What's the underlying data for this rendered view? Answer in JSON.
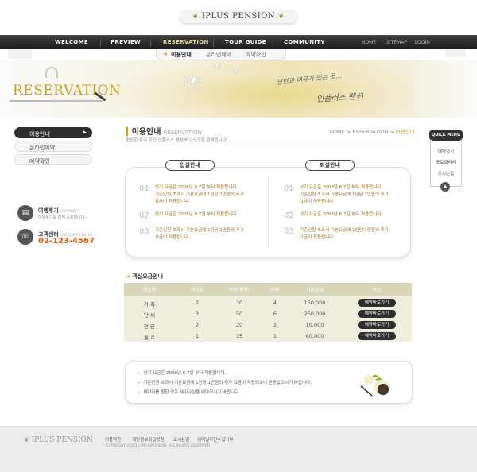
{
  "brand": {
    "logo": "IPLUS PENSION"
  },
  "nav": {
    "items": [
      "WELCOME",
      "PREVIEW",
      "RESERVATION",
      "TOUR GUIDE",
      "COMMUNITY"
    ],
    "active": "RESERVATION",
    "utility": [
      "HOME",
      "SITEMAP",
      "LOGIN"
    ],
    "sub": [
      "이용안내",
      "온라인예약",
      "예약확인"
    ]
  },
  "banner": {
    "title": "RESERVATION",
    "script1": "낭만과 여유가 있는 곳...",
    "script2": "인플러스 펜션"
  },
  "sidebar": {
    "items": [
      "이용안내",
      "온라인예약",
      "예약확인"
    ],
    "review": {
      "title": "여행후기",
      "en": "COMMUNITY",
      "text": "여행후기를 함께 공유합니다."
    },
    "center": {
      "title": "고객센터",
      "en": "CUSTOMER CENTER",
      "phone": "02-123-4567"
    }
  },
  "page": {
    "title": "이용안내",
    "title_en": "RESERVATION",
    "breadcrumb": {
      "home": "HOME",
      "sep": " > ",
      "section": "RESERVATION",
      "current": "이용안내"
    },
    "desc": "편안한 휴식 공간 인플러스 펜션에 오신것을 환영합니다."
  },
  "checkin": {
    "title": "입실안내",
    "items": [
      {
        "num": "01",
        "lines": [
          "성기 요금은 2008년 6.7일 부터 적용합니다",
          "기준인원 초과시 기본요금에 1인당 1만원의 추가",
          "요금이 적용됩니다."
        ]
      },
      {
        "num": "02",
        "lines": [
          "성기 요금은 2008년 6.7일 부터 적용합니다"
        ]
      },
      {
        "num": "03",
        "lines": [
          "기준인원 초과시 기본요금에 1인당 1만원의 추가",
          "요금이 적용됩니다."
        ]
      }
    ]
  },
  "checkout": {
    "title": "퇴실안내",
    "items": [
      {
        "num": "01",
        "lines": [
          "성기 요금은 2008년 6.7일 부터 적용합니다",
          "기준인원 초과시 기본요금에 1인당 1만원의 추가",
          "요금이 적용됩니다."
        ]
      },
      {
        "num": "02",
        "lines": [
          "성기 요금은 2008년 6.7일 부터 적용합니다"
        ]
      },
      {
        "num": "03",
        "lines": [
          "기준인원 초과시 기본요금에 1인당 1만원의 추가",
          "요금이 적용됩니다."
        ]
      }
    ]
  },
  "rates": {
    "title": "객실요금안내",
    "headers": [
      "객실명",
      "객실수",
      "면적(평형)",
      "인원",
      "기본요금",
      "비고"
    ],
    "rows": [
      {
        "name": "가 족",
        "count": "2",
        "area": "30",
        "people": "4",
        "price": "150,000",
        "btn": "예약바로가기"
      },
      {
        "name": "단 체",
        "count": "3",
        "area": "50",
        "people": "6",
        "price": "250,000",
        "btn": "예약바로가기"
      },
      {
        "name": "연 인",
        "count": "2",
        "area": "20",
        "people": "2",
        "price": "10,000",
        "btn": "예약바로가기"
      },
      {
        "name": "홀 로",
        "count": "1",
        "area": "15",
        "people": "1",
        "price": "60,000",
        "btn": "예약바로가기"
      }
    ]
  },
  "notes": [
    "성기 요금은 2008년 6.7일 부터 적용합니다.",
    "기준인원 초과시 기본요금에 1인당 1만원의 추가 요금이 적용되오니 혼동없으시기 바랍니다.",
    "세미나를 원한 경우 세미나실을 예약하시기 바랍니다."
  ],
  "quick_menu": {
    "title": "QUICK MENU",
    "items": [
      "예약하기",
      "포토갤러리",
      "오시는길"
    ]
  },
  "footer": {
    "logo": "IPLUS PENSION",
    "links": [
      "이용약관",
      "개인정보취급방침",
      "오시는길",
      "이메일무단수집거부"
    ],
    "copyright": "COPYRIGHT ©2010 IPLUSPENSION. ALL RIGHTS RESERVED"
  },
  "colors": {
    "accent": "#c8a020",
    "dark": "#2e2e2e",
    "table_head": "#d8d5b8",
    "table_body": "#efeedd"
  }
}
